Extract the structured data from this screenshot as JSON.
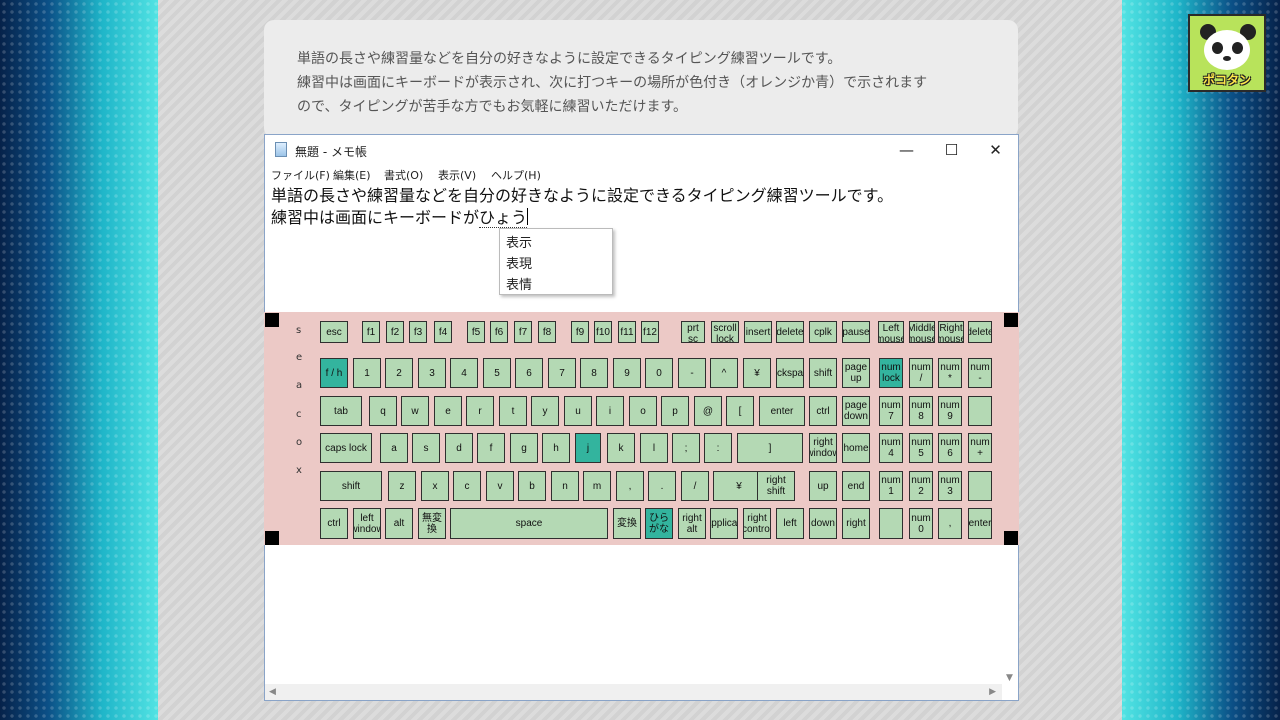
{
  "info": {
    "lines": [
      "単語の長さや練習量などを自分の好きなように設定できるタイピング練習ツールです。",
      "練習中は画面にキーボードが表示され、次に打つキーの場所が色付き（オレンジか青）で示されます",
      "ので、タイピングが苦手な方でもお気軽に練習いただけます。"
    ]
  },
  "avatar": {
    "text": "ポコタン"
  },
  "window": {
    "title": "無題 - メモ帳",
    "buttons": {
      "minimize": "—",
      "maximize": "☐",
      "close": "✕"
    },
    "menu": [
      "ファイル(F)",
      "編集(E)",
      "書式(O)",
      "表示(V)",
      "ヘルプ(H)"
    ],
    "editor": {
      "line1": "単語の長さや練習量などを自分の好きなように設定できるタイピング練習ツールです。",
      "line2_committed": "練習中は画面にキーボードが",
      "line2_composing": "ひょう"
    },
    "candidates": [
      "表示",
      "表現",
      "表情"
    ]
  },
  "keyboard": {
    "side_label": [
      "s",
      "e",
      "a",
      "c",
      "o",
      "x"
    ],
    "highlight_color": "#33b49e",
    "key_color": "#b4d9b4",
    "rows": [
      [
        {
          "l": "esc"
        },
        {
          "l": "f1"
        },
        {
          "l": "f2"
        },
        {
          "l": "f3"
        },
        {
          "l": "f4"
        },
        {
          "l": "f5"
        },
        {
          "l": "f6"
        },
        {
          "l": "f7"
        },
        {
          "l": "f8"
        },
        {
          "l": "f9"
        },
        {
          "l": "f10"
        },
        {
          "l": "f11"
        },
        {
          "l": "f12"
        },
        {
          "l": "prt\nsc"
        },
        {
          "l": "scroll\nlock"
        },
        {
          "l": "insert"
        },
        {
          "l": "delete"
        },
        {
          "l": "cplk"
        },
        {
          "l": "pause"
        },
        {
          "l": "Left\nmouse"
        },
        {
          "l": "Middle\nmouse"
        },
        {
          "l": "Right\nmouse"
        },
        {
          "l": "delete"
        }
      ],
      [
        {
          "l": "f / h",
          "hl": true
        },
        {
          "l": "1"
        },
        {
          "l": "2"
        },
        {
          "l": "3"
        },
        {
          "l": "4"
        },
        {
          "l": "5"
        },
        {
          "l": "6"
        },
        {
          "l": "7"
        },
        {
          "l": "8"
        },
        {
          "l": "9"
        },
        {
          "l": "0"
        },
        {
          "l": "-"
        },
        {
          "l": "^"
        },
        {
          "l": "¥"
        },
        {
          "l": "ckspa"
        },
        {
          "l": "shift"
        },
        {
          "l": "page\nup"
        },
        {
          "l": "num\nlock",
          "hl": true
        },
        {
          "l": "num\n/"
        },
        {
          "l": "num\n*"
        },
        {
          "l": "num\n-"
        }
      ],
      [
        {
          "l": "tab"
        },
        {
          "l": "q"
        },
        {
          "l": "w"
        },
        {
          "l": "e"
        },
        {
          "l": "r"
        },
        {
          "l": "t"
        },
        {
          "l": "y"
        },
        {
          "l": "u"
        },
        {
          "l": "i"
        },
        {
          "l": "o"
        },
        {
          "l": "p"
        },
        {
          "l": "@"
        },
        {
          "l": "["
        },
        {
          "l": "enter"
        },
        {
          "l": "ctrl"
        },
        {
          "l": "page\ndown"
        },
        {
          "l": "num\n7"
        },
        {
          "l": "num\n8"
        },
        {
          "l": "num\n9"
        },
        {
          "l": ""
        }
      ],
      [
        {
          "l": "caps lock"
        },
        {
          "l": "a"
        },
        {
          "l": "s"
        },
        {
          "l": "d"
        },
        {
          "l": "f"
        },
        {
          "l": "g"
        },
        {
          "l": "h"
        },
        {
          "l": "j",
          "hl": true
        },
        {
          "l": "k"
        },
        {
          "l": "l"
        },
        {
          "l": ";"
        },
        {
          "l": ":"
        },
        {
          "l": "]"
        },
        {
          "l": "right\nwindow"
        },
        {
          "l": "home"
        },
        {
          "l": "num\n4"
        },
        {
          "l": "num\n5"
        },
        {
          "l": "num\n6"
        },
        {
          "l": "num\n+"
        }
      ],
      [
        {
          "l": "shift"
        },
        {
          "l": "z"
        },
        {
          "l": "x"
        },
        {
          "l": "c"
        },
        {
          "l": "v"
        },
        {
          "l": "b"
        },
        {
          "l": "n"
        },
        {
          "l": "m"
        },
        {
          "l": ","
        },
        {
          "l": "."
        },
        {
          "l": "/"
        },
        {
          "l": "¥"
        },
        {
          "l": "right\nshift"
        },
        {
          "l": "up"
        },
        {
          "l": "end"
        },
        {
          "l": "num\n1"
        },
        {
          "l": "num\n2"
        },
        {
          "l": "num\n3"
        },
        {
          "l": ""
        }
      ],
      [
        {
          "l": "ctrl"
        },
        {
          "l": "left\nwindow"
        },
        {
          "l": "alt"
        },
        {
          "l": "無変\n換"
        },
        {
          "l": "space"
        },
        {
          "l": "変換"
        },
        {
          "l": "ひら\nがな",
          "hl": true
        },
        {
          "l": "right\nalt"
        },
        {
          "l": "applicati"
        },
        {
          "l": "right\ncontrol"
        },
        {
          "l": "left"
        },
        {
          "l": "down"
        },
        {
          "l": "right"
        },
        {
          "l": ""
        },
        {
          "l": "num\n0"
        },
        {
          "l": ","
        },
        {
          "l": "enter"
        }
      ]
    ]
  }
}
